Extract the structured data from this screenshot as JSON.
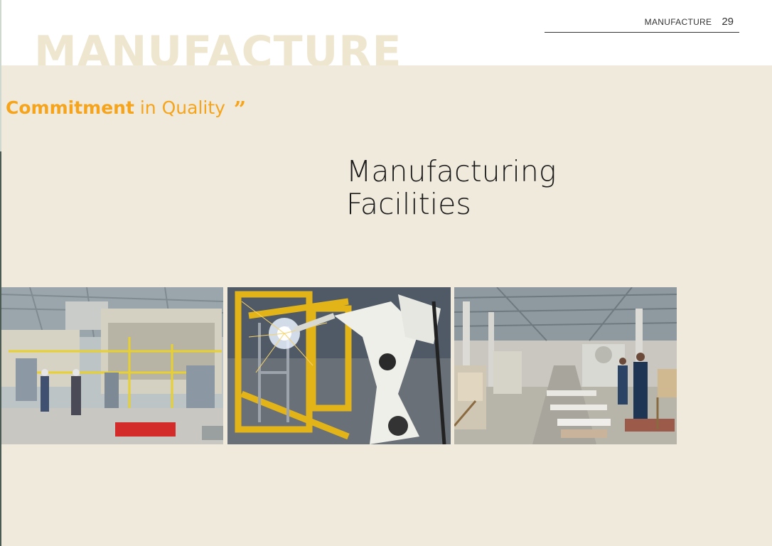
{
  "watermark_title": "MANUFACTURE",
  "running_head": {
    "section": "MANUFACTURE",
    "page_number": "29"
  },
  "tagline": {
    "bold": "Commitment",
    "light": "in Quality",
    "quote": "”"
  },
  "heading": {
    "line1": "Manufacturing",
    "line2": "Facilities"
  },
  "colors": {
    "panel": "#f0eadc",
    "accent": "#f5a41b",
    "watermark": "#efe6cf"
  },
  "photos": [
    {
      "subject": "powder-coating-line"
    },
    {
      "subject": "robotic-welding"
    },
    {
      "subject": "assembly-hall"
    }
  ]
}
